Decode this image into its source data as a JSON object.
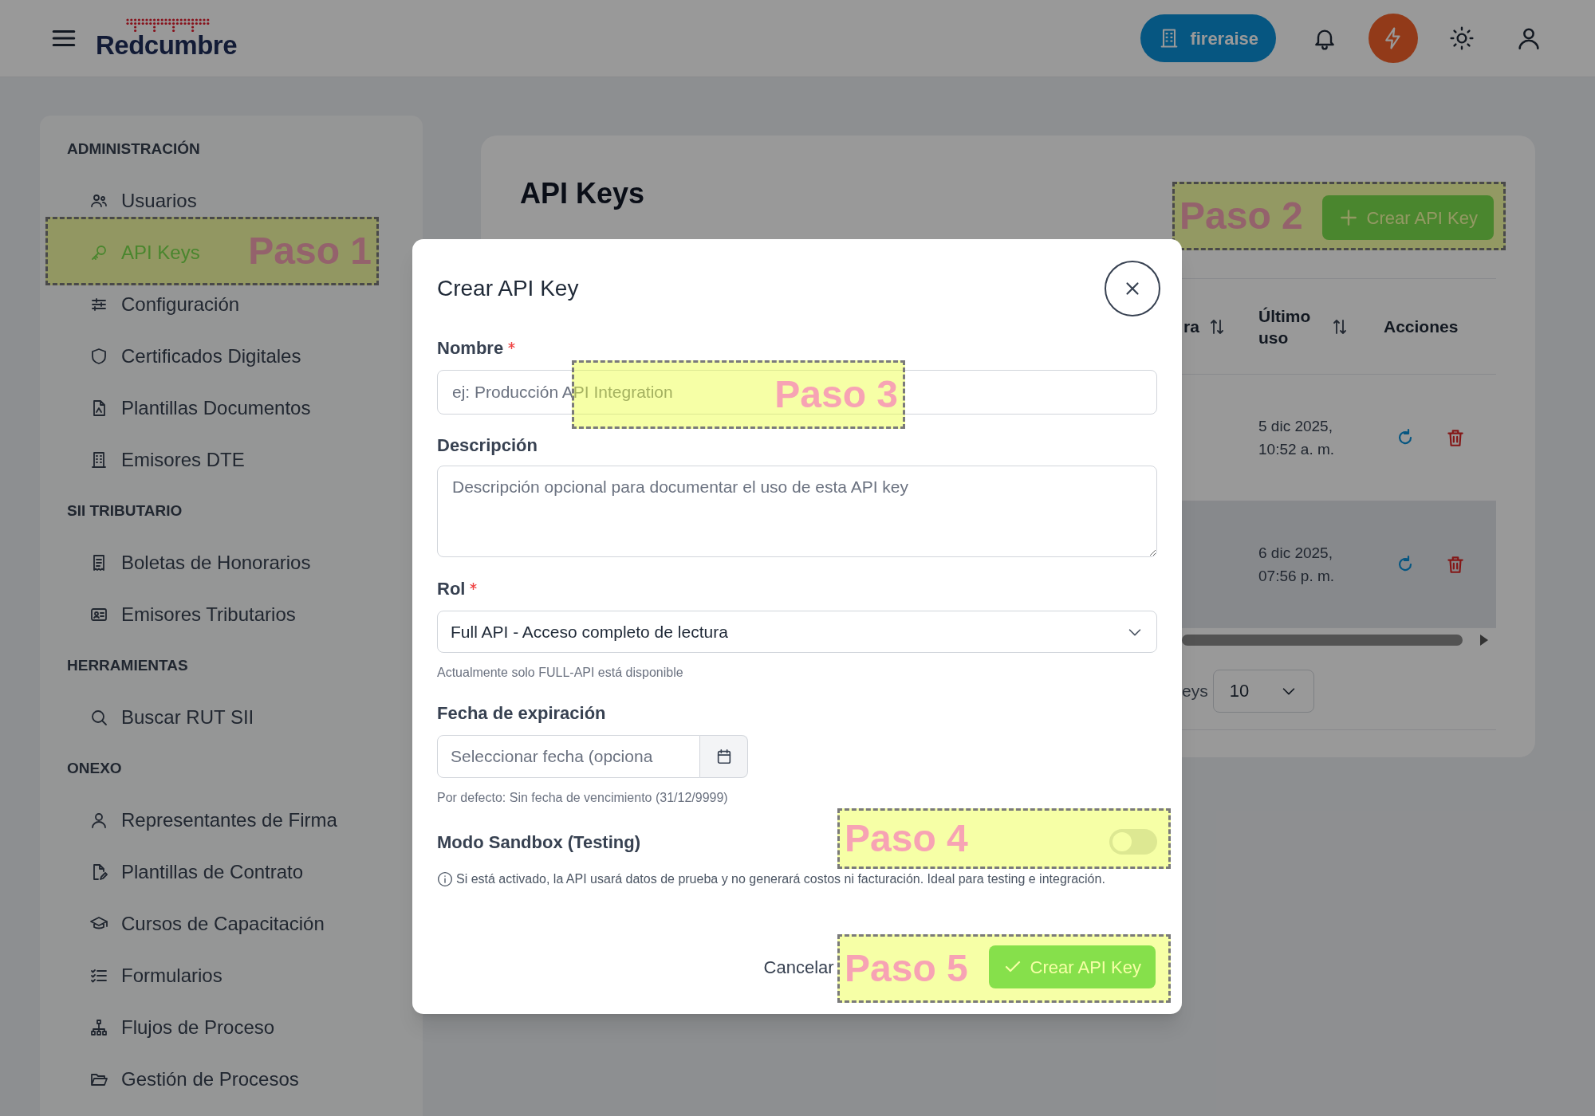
{
  "topbar": {
    "brand": "Redcumbre",
    "org_button": "fireraise"
  },
  "sidebar": {
    "sections": [
      {
        "title": "ADMINISTRACIÓN",
        "items": [
          {
            "label": "Usuarios",
            "selected": false
          },
          {
            "label": "API Keys",
            "selected": true
          },
          {
            "label": "Configuración",
            "selected": false
          },
          {
            "label": "Certificados Digitales",
            "selected": false
          },
          {
            "label": "Plantillas Documentos",
            "selected": false
          },
          {
            "label": "Emisores DTE",
            "selected": false
          }
        ]
      },
      {
        "title": "SII TRIBUTARIO",
        "items": [
          {
            "label": "Boletas de Honorarios",
            "selected": false
          },
          {
            "label": "Emisores Tributarios",
            "selected": false
          }
        ]
      },
      {
        "title": "HERRAMIENTAS",
        "items": [
          {
            "label": "Buscar RUT SII",
            "selected": false
          }
        ]
      },
      {
        "title": "ONEXO",
        "items": [
          {
            "label": "Representantes de Firma",
            "selected": false
          },
          {
            "label": "Plantillas de Contrato",
            "selected": false
          },
          {
            "label": "Cursos de Capacitación",
            "selected": false
          },
          {
            "label": "Formularios",
            "selected": false
          },
          {
            "label": "Flujos de Proceso",
            "selected": false
          },
          {
            "label": "Gestión de Procesos",
            "selected": false
          }
        ]
      }
    ]
  },
  "page": {
    "title": "API Keys",
    "create_button": "Crear API Key",
    "table": {
      "columns": [
        {
          "label": "ra",
          "sortable": true
        },
        {
          "label": "Último uso",
          "sortable": true
        },
        {
          "label": "Acciones",
          "sortable": false
        }
      ],
      "rows": [
        {
          "last_used": "5 dic 2025, 10:52 a. m.",
          "highlighted": false
        },
        {
          "last_used": "6 dic 2025, 07:56 p. m.",
          "highlighted": true
        }
      ],
      "page_size_label": "eys",
      "page_size": "10"
    }
  },
  "dialog": {
    "title": "Crear API Key",
    "fields": [
      {
        "kind": "text",
        "label": "Nombre",
        "required": true,
        "placeholder": "ej: Producción API Integration"
      },
      {
        "kind": "textarea",
        "label": "Descripción",
        "required": false,
        "placeholder": "Descripción opcional para documentar el uso de esta API key"
      },
      {
        "kind": "select",
        "label": "Rol",
        "required": true,
        "value": "Full API - Acceso completo de lectura",
        "help": "Actualmente solo FULL-API está disponible"
      },
      {
        "kind": "date",
        "label": "Fecha de expiración",
        "required": false,
        "placeholder": "Seleccionar fecha (opciona",
        "help": "Por defecto: Sin fecha de vencimiento (31/12/9999)"
      },
      {
        "kind": "toggle",
        "label": "Modo Sandbox (Testing)",
        "on": false,
        "info": "Si está activado, la API usará datos de prueba y no generará costos ni facturación. Ideal para testing e integración."
      }
    ],
    "buttons": [
      {
        "kind": "cancel",
        "label": "Cancelar"
      },
      {
        "kind": "primary",
        "label": "Crear API Key"
      }
    ]
  },
  "annotations": [
    {
      "label": "Paso 1"
    },
    {
      "label": "Paso 2"
    },
    {
      "label": "Paso 3"
    },
    {
      "label": "Paso 4"
    },
    {
      "label": "Paso 5"
    }
  ]
}
